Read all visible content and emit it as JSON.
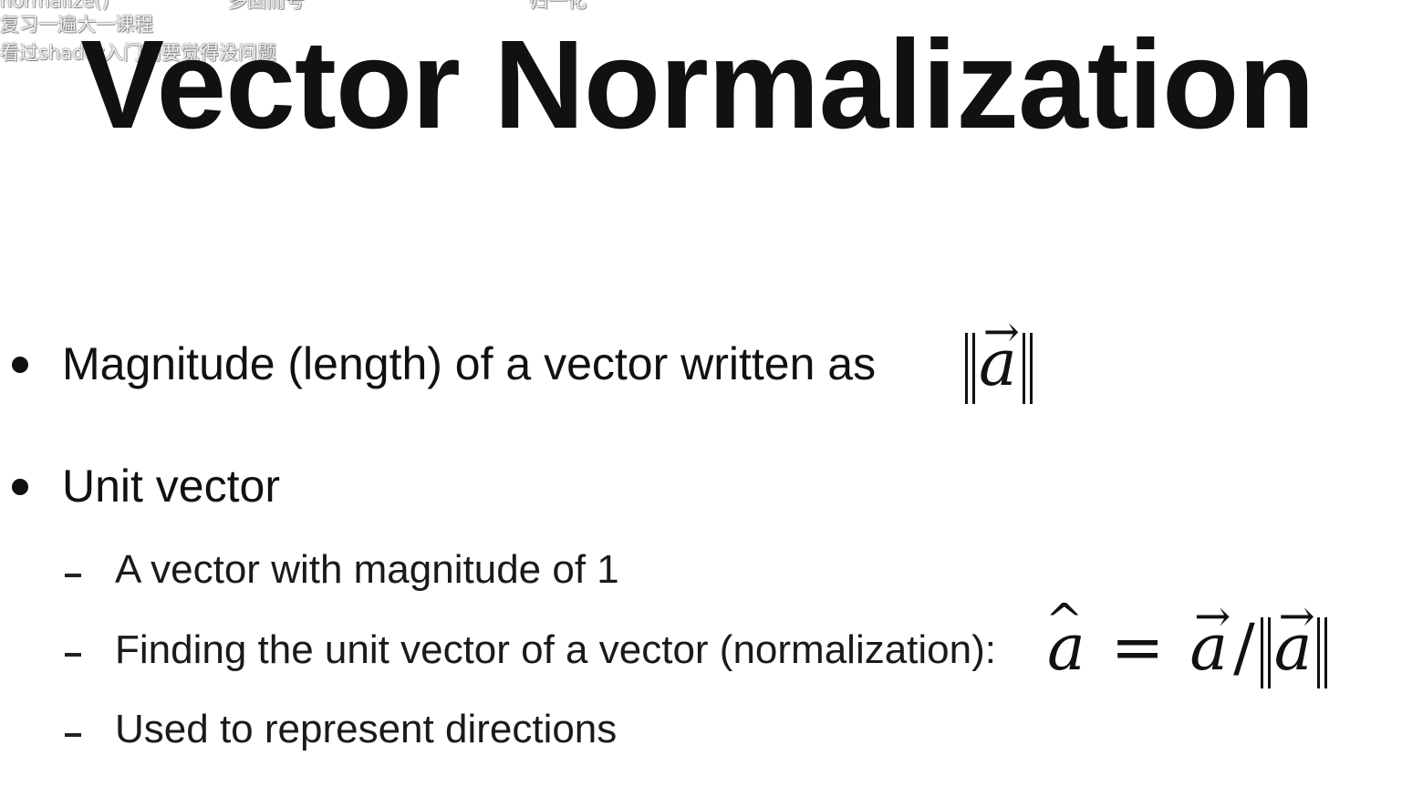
{
  "danmaku": [
    "normalize()",
    "多回而号",
    "归一化",
    "复习一遍大一课程",
    "看过shader入门精要觉得没问题"
  ],
  "title": "Vector Normalization",
  "bullets": [
    {
      "text": "Magnitude (length) of a vector written as",
      "math": "||a⃗||"
    },
    {
      "text": "Unit vector",
      "subitems": [
        {
          "text": "A vector with magnitude of 1"
        },
        {
          "text": "Finding the unit vector of a vector (normalization):",
          "math": "â = a⃗/||a⃗||"
        },
        {
          "text": "Used to represent directions"
        }
      ]
    }
  ],
  "math_symbols": {
    "a": "a",
    "arrow": "→",
    "hat": "^",
    "equals": "=",
    "slash": "/"
  }
}
